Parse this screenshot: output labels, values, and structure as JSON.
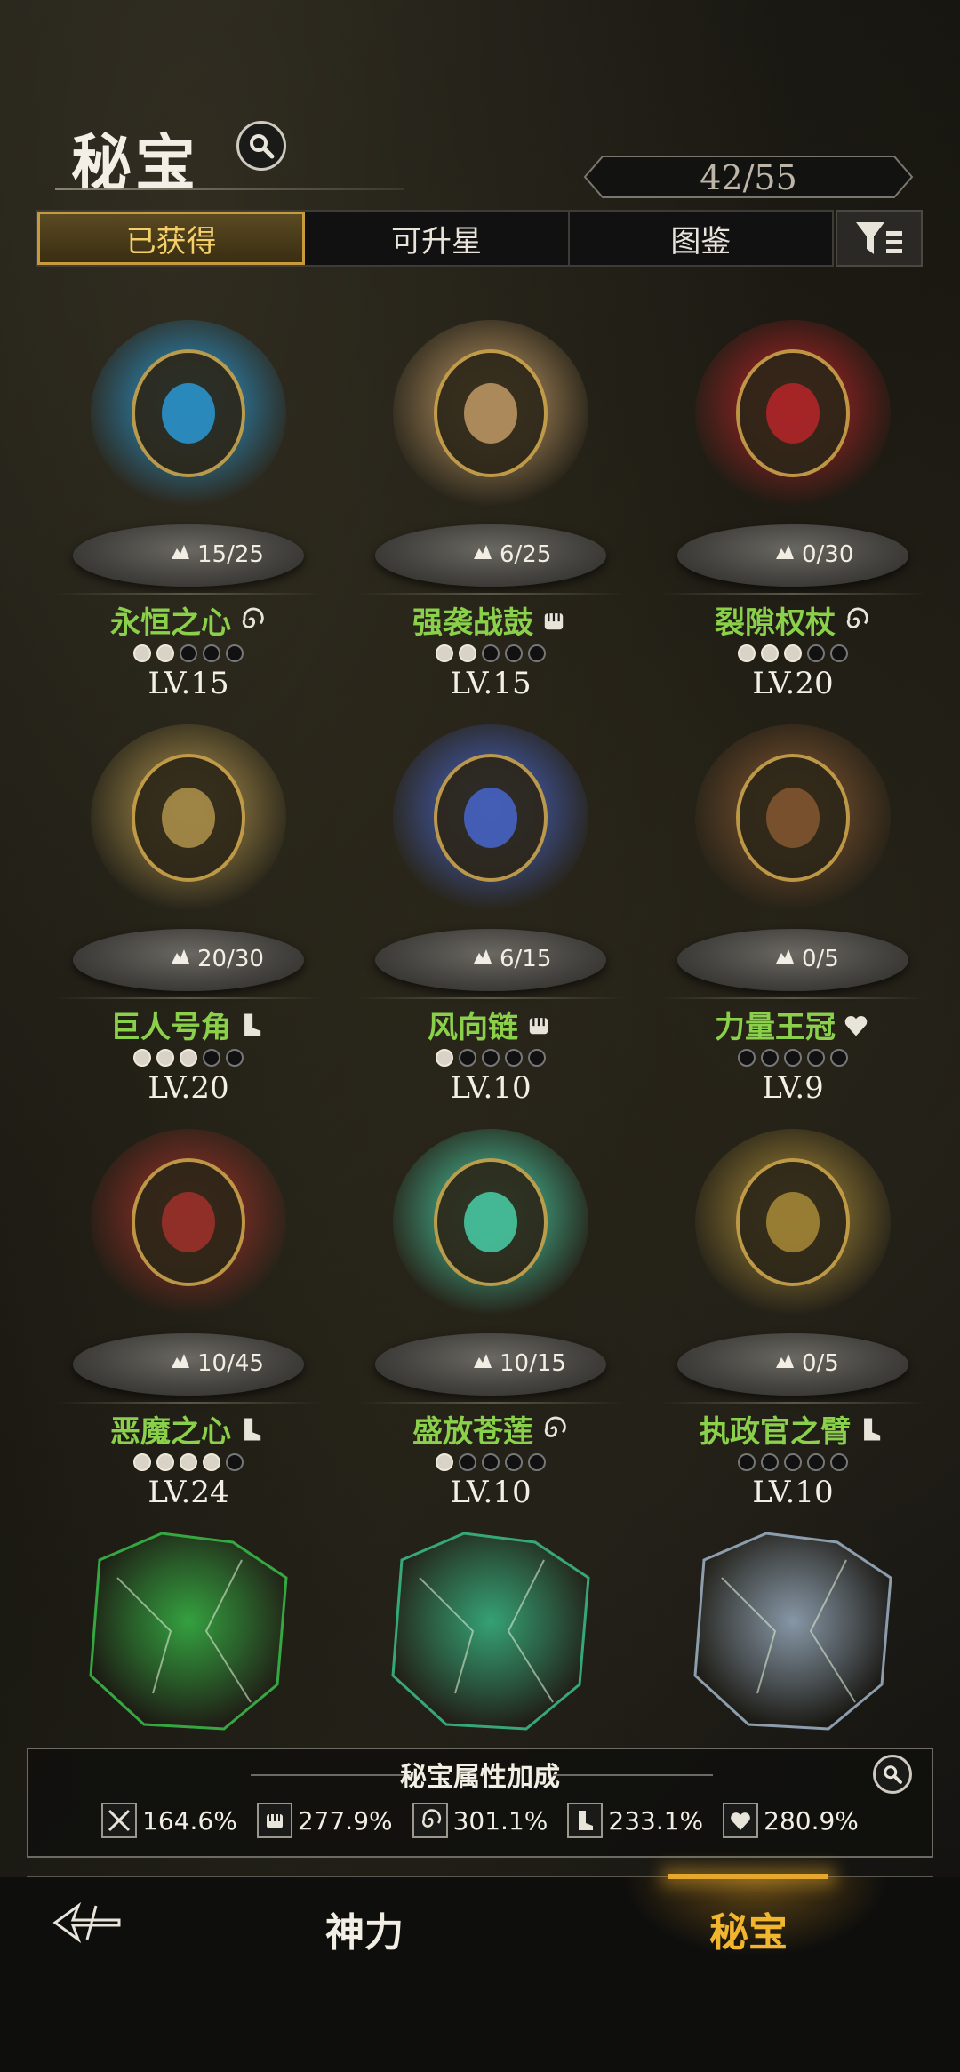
{
  "header": {
    "title": "秘宝",
    "counter": "42/55"
  },
  "tabs": [
    {
      "label": "已获得",
      "active": true
    },
    {
      "label": "可升星",
      "active": false
    },
    {
      "label": "图鉴",
      "active": false
    }
  ],
  "treasures": [
    {
      "name": "永恒之心",
      "shards": "15/25",
      "level": "LV.15",
      "stars_on": 2,
      "stars_total": 5,
      "type": "spiral",
      "color": "#2aa0e0"
    },
    {
      "name": "强袭战鼓",
      "shards": "6/25",
      "level": "LV.15",
      "stars_on": 2,
      "stars_total": 5,
      "type": "fist",
      "color": "#c9a06a"
    },
    {
      "name": "裂隙权杖",
      "shards": "0/30",
      "level": "LV.20",
      "stars_on": 3,
      "stars_total": 5,
      "type": "spiral",
      "color": "#c0262a"
    },
    {
      "name": "巨人号角",
      "shards": "20/30",
      "level": "LV.20",
      "stars_on": 3,
      "stars_total": 5,
      "type": "boot",
      "color": "#b89a50"
    },
    {
      "name": "风向链",
      "shards": "6/15",
      "level": "LV.10",
      "stars_on": 1,
      "stars_total": 5,
      "type": "fist",
      "color": "#4a6ad8"
    },
    {
      "name": "力量王冠",
      "shards": "0/5",
      "level": "LV.9",
      "stars_on": 0,
      "stars_total": 5,
      "type": "heart",
      "color": "#8a5a32"
    },
    {
      "name": "恶魔之心",
      "shards": "10/45",
      "level": "LV.24",
      "stars_on": 4,
      "stars_total": 5,
      "type": "boot",
      "color": "#a8322a"
    },
    {
      "name": "盛放苍莲",
      "shards": "10/15",
      "level": "LV.10",
      "stars_on": 1,
      "stars_total": 5,
      "type": "spiral",
      "color": "#4ad8b0"
    },
    {
      "name": "执政官之臂",
      "shards": "0/5",
      "level": "LV.10",
      "stars_on": 0,
      "stars_total": 5,
      "type": "boot",
      "color": "#b0903a"
    },
    {
      "name": "",
      "shards": "",
      "level": "",
      "stars_on": 0,
      "stars_total": 0,
      "type": "",
      "color": "#3ac04a"
    },
    {
      "name": "",
      "shards": "",
      "level": "",
      "stars_on": 0,
      "stars_total": 0,
      "type": "",
      "color": "#3ac08a"
    },
    {
      "name": "",
      "shards": "",
      "level": "",
      "stars_on": 0,
      "stars_total": 0,
      "type": "",
      "color": "#a0b4c8"
    }
  ],
  "bonus": {
    "title": "秘宝属性加成",
    "stats": [
      {
        "icon": "sword-icon",
        "value": "164.6%"
      },
      {
        "icon": "fist-icon",
        "value": "277.9%"
      },
      {
        "icon": "spiral-icon",
        "value": "301.1%"
      },
      {
        "icon": "boot-icon",
        "value": "233.1%"
      },
      {
        "icon": "heart-icon",
        "value": "280.9%"
      }
    ]
  },
  "nav": {
    "god_label": "神力",
    "secret_label": "秘宝"
  }
}
